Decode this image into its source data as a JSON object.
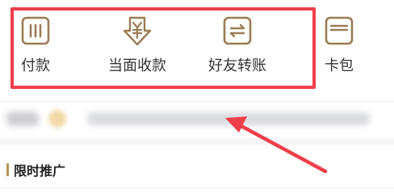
{
  "quick_actions": [
    {
      "label": "付款",
      "icon": "pay-code-icon"
    },
    {
      "label": "当面收款",
      "icon": "yuan-receive-icon"
    },
    {
      "label": "好友转账",
      "icon": "transfer-arrows-icon"
    },
    {
      "label": "卡包",
      "icon": "card-wallet-icon"
    }
  ],
  "section": {
    "title": "限时推广"
  },
  "colors": {
    "icon_stroke": "#9b7c55",
    "highlight": "#ef3f4a",
    "accent_bar": "#b89358",
    "label_text": "#333333"
  }
}
